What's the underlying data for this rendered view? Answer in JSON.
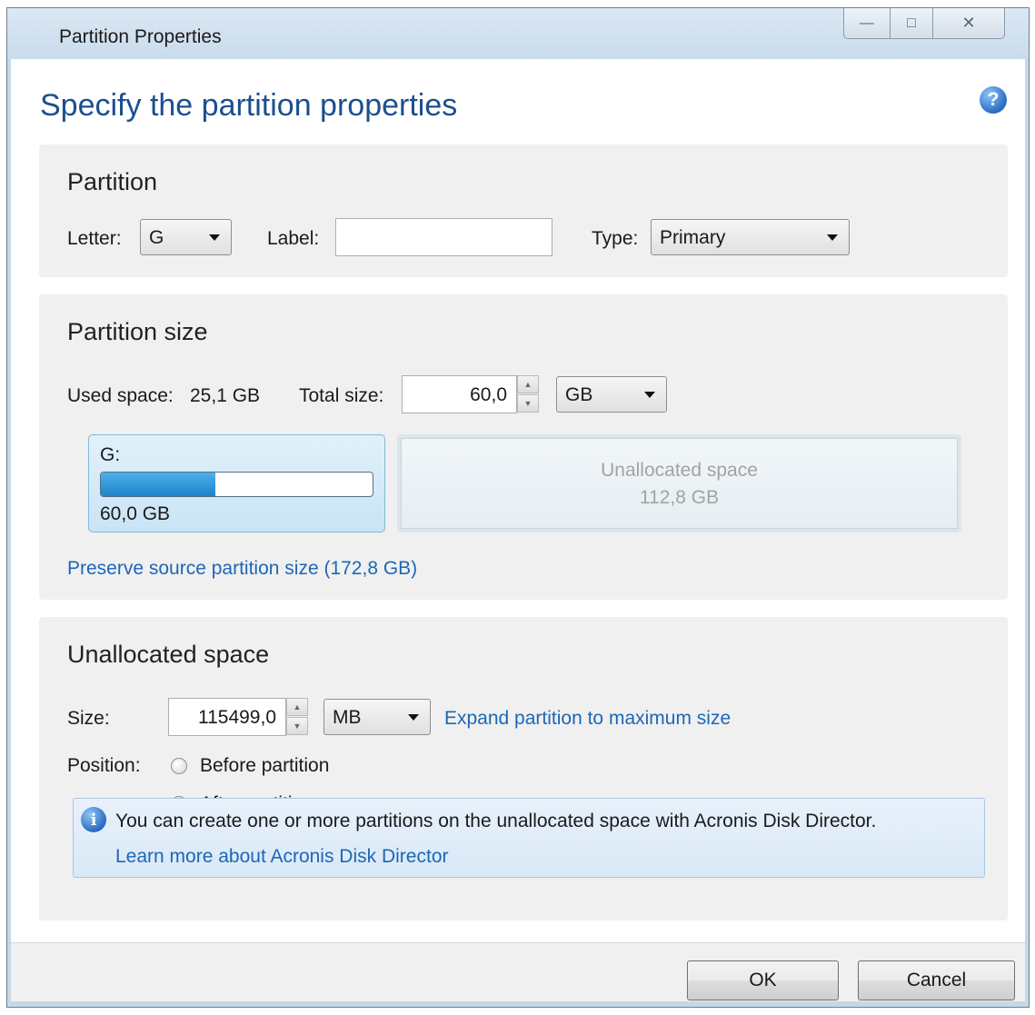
{
  "window": {
    "title": "Partition Properties",
    "controls": {
      "minimize": "—",
      "maximize": "□",
      "close": "✕"
    }
  },
  "heading": "Specify the partition properties",
  "help_icon": "?",
  "partition": {
    "title": "Partition",
    "letter_label": "Letter:",
    "letter_value": "G",
    "label_label": "Label:",
    "label_value": "",
    "type_label": "Type:",
    "type_value": "Primary"
  },
  "partition_size": {
    "title": "Partition size",
    "used_space_label": "Used space:",
    "used_space_value": "25,1 GB",
    "total_size_label": "Total size:",
    "total_size_value": "60,0",
    "unit": "GB",
    "partition_letter": "G:",
    "partition_size": "60,0 GB",
    "usage_fraction": 0.42,
    "unallocated_label": "Unallocated space",
    "unallocated_size": "112,8 GB",
    "preserve_link": "Preserve source partition size (172,8 GB)"
  },
  "unallocated": {
    "title": "Unallocated space",
    "size_label": "Size:",
    "size_value": "115499,0",
    "unit": "MB",
    "expand_link": "Expand partition to maximum size",
    "position_label": "Position:",
    "options": [
      {
        "label": "Before partition",
        "checked": false
      },
      {
        "label": "After partition",
        "checked": true
      }
    ]
  },
  "info": {
    "icon": "i",
    "text": "You can create one or more partitions on the unallocated space with Acronis Disk Director.",
    "link": "Learn more about Acronis Disk Director"
  },
  "buttons": {
    "ok": "OK",
    "cancel": "Cancel"
  }
}
